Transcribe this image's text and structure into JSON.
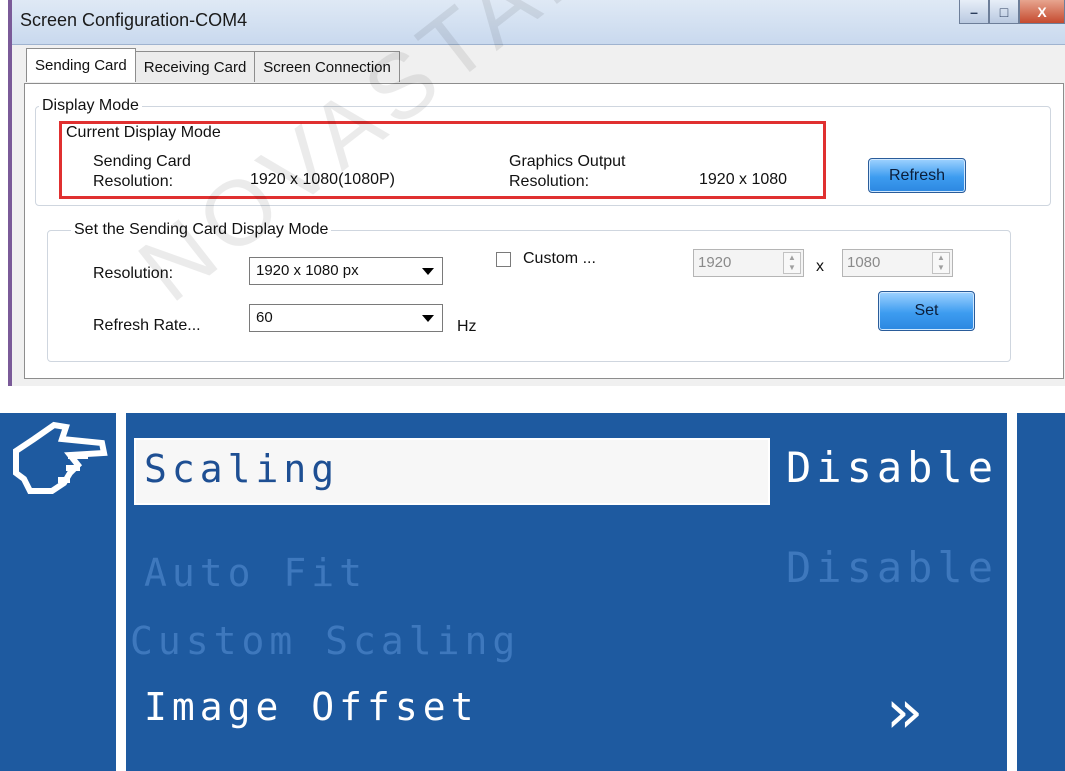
{
  "window": {
    "title": "Screen Configuration-COM4",
    "minimize_glyph": "–",
    "maximize_glyph": "□",
    "close_glyph": "X"
  },
  "tabs": [
    {
      "label": "Sending Card",
      "active": true
    },
    {
      "label": "Receiving Card",
      "active": false
    },
    {
      "label": "Screen Connection",
      "active": false
    }
  ],
  "display_mode": {
    "group_label": "Display Mode",
    "current": {
      "group_label": "Current Display Mode",
      "sending_card_label_1": "Sending Card",
      "sending_card_label_2": "Resolution:",
      "sending_card_value": "1920 x 1080(1080P)",
      "graphics_label_1": "Graphics Output",
      "graphics_label_2": "Resolution:",
      "graphics_value": "1920 x 1080",
      "refresh_button": "Refresh"
    },
    "set_mode": {
      "group_label": "Set the Sending Card Display Mode",
      "resolution_label": "Resolution:",
      "resolution_value": "1920 x 1080 px",
      "custom_label": "Custom ...",
      "custom_checked": false,
      "custom_width": "1920",
      "custom_times": "x",
      "custom_height": "1080",
      "refresh_rate_label": "Refresh Rate...",
      "refresh_rate_value": "60",
      "hz_label": "Hz",
      "set_button": "Set"
    }
  },
  "lcd_menu": {
    "pointer_icon": "hand-pointer-icon",
    "items": [
      {
        "label": "Scaling",
        "value": "Disable",
        "state": "selected"
      },
      {
        "label": "Auto Fit",
        "value": "Disable",
        "state": "disabled"
      },
      {
        "label": "Custom Scaling",
        "value": "",
        "state": "disabled"
      },
      {
        "label": "Image Offset",
        "value": "»",
        "state": "enabled"
      }
    ]
  },
  "watermark": "NOVASTAR TECH CO.,LTD",
  "colors": {
    "lcd_background": "#1e5aa0",
    "highlight_box": "#e03030",
    "button_blue": "#3d9cf0"
  }
}
